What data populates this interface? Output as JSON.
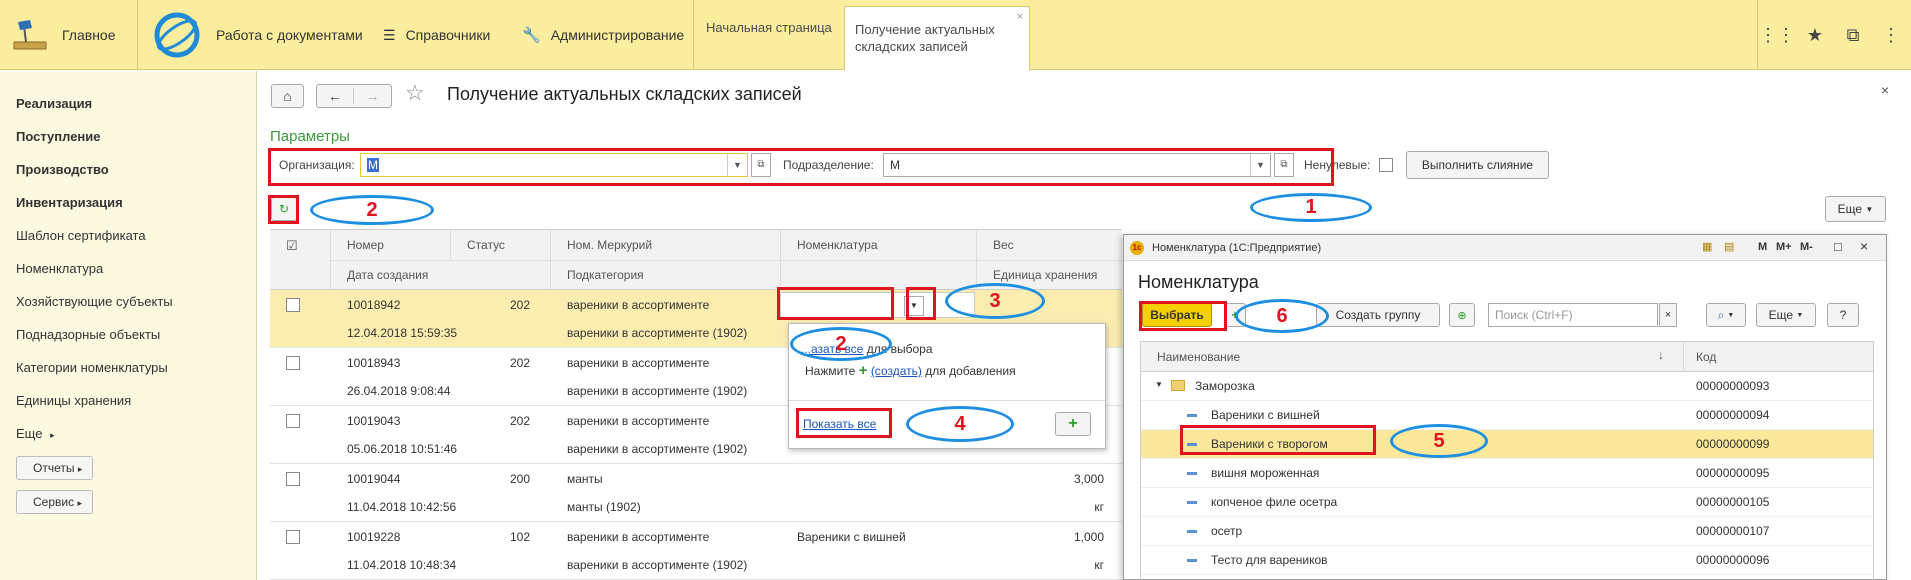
{
  "topbar": {
    "home_label": "Главное",
    "docs_label": "Работа с документами",
    "ref_label": "Справочники",
    "admin_label": "Администрирование",
    "tabs": [
      {
        "label": "Начальная страница"
      },
      {
        "label": "Получение актуальных складских записей",
        "close": "×"
      }
    ]
  },
  "sidebar": {
    "items": [
      {
        "label": "Реализация"
      },
      {
        "label": "Поступление"
      },
      {
        "label": "Производство"
      },
      {
        "label": "Инвентаризация"
      },
      {
        "label": "Шаблон сертификата"
      },
      {
        "label": "Номенклатура"
      },
      {
        "label": "Хозяйствующие субъекты"
      },
      {
        "label": "Поднадзорные объекты"
      },
      {
        "label": "Категории номенклатуры"
      },
      {
        "label": "Единицы хранения"
      },
      {
        "label": "Еще"
      }
    ],
    "reports_btn": "Отчеты",
    "service_btn": "Сервис"
  },
  "page": {
    "title": "Получение актуальных складских записей",
    "close": "×",
    "params_link": "Параметры",
    "org_label": "Организация:",
    "org_value": "М",
    "dept_label": "Подразделение:",
    "dept_value": "М",
    "nonzero_label": "Ненулевые:",
    "merge_btn": "Выполнить слияние",
    "more_btn": "Еще"
  },
  "grid": {
    "headers": {
      "number": "Номер",
      "status": "Статус",
      "merc": "Ном. Меркурий",
      "nom": "Номенклатура",
      "weight": "Вес",
      "created": "Дата создания",
      "subcat": "Подкатегория",
      "unit": "Единица хранения"
    },
    "rows": [
      {
        "number": "10018942",
        "status": "202",
        "merc": "вареники в ассортименте",
        "nom": "",
        "weight": "",
        "date": "12.04.2018 15:59:35",
        "subcat": "вареники в ассортименте (1902)",
        "unit": ""
      },
      {
        "number": "10018943",
        "status": "202",
        "merc": "вареники в ассортименте",
        "nom": "",
        "weight": "",
        "date": "26.04.2018 9:08:44",
        "subcat": "вареники в ассортименте (1902)",
        "unit": ""
      },
      {
        "number": "10019043",
        "status": "202",
        "merc": "вареники в ассортименте",
        "nom": "",
        "weight": "",
        "date": "05.06.2018 10:51:46",
        "subcat": "вареники в ассортименте (1902)",
        "unit": ""
      },
      {
        "number": "10019044",
        "status": "200",
        "merc": "манты",
        "nom": "",
        "weight": "3,000",
        "date": "11.04.2018 10:42:56",
        "subcat": "манты (1902)",
        "unit": "кг"
      },
      {
        "number": "10019228",
        "status": "102",
        "merc": "вареники в ассортименте",
        "nom": "Вареники с вишней",
        "weight": "1,000",
        "date": "11.04.2018 10:48:34",
        "subcat": "вареники в ассортименте (1902)",
        "unit": "кг"
      }
    ]
  },
  "popup": {
    "line1_link": "...азать все",
    "line1_text": "для выбора",
    "line2_prefix": "Нажмите",
    "line2_link": "(создать)",
    "line2_text": "для добавления",
    "show_all": "Показать все"
  },
  "dialog": {
    "window_title": "Номенклатура (1С:Предприятие)",
    "title_btns": [
      "M",
      "M+",
      "M-"
    ],
    "heading": "Номенклатура",
    "select_btn": "Выбрать",
    "create_group_btn": "Создать группу",
    "search_placeholder": "Поиск (Ctrl+F)",
    "more_btn": "Еще",
    "help_btn": "?",
    "col_name": "Наименование",
    "col_code": "Код",
    "rows": [
      {
        "name": "Заморозка",
        "code": "00000000093",
        "folder": true
      },
      {
        "name": "Вареники с вишней",
        "code": "00000000094"
      },
      {
        "name": "Вареники с творогом",
        "code": "00000000099"
      },
      {
        "name": "вишня мороженная",
        "code": "00000000095"
      },
      {
        "name": "копченое филе осетра",
        "code": "00000000105"
      },
      {
        "name": "осетр",
        "code": "00000000107"
      },
      {
        "name": "Тесто для вареников",
        "code": "00000000096"
      }
    ]
  },
  "annotations": {
    "n1": "1",
    "n2a": "2",
    "n2b": "2",
    "n3": "3",
    "n4": "4",
    "n5": "5",
    "n6": "6"
  },
  "colors": {
    "accent_red": "#e0141e",
    "annotation_blue": "#1d8fe1",
    "topbar_yellow": "#fbed9e",
    "selection_yellow": "#fbedb0",
    "sidebar_bg": "#fbf9e0"
  }
}
